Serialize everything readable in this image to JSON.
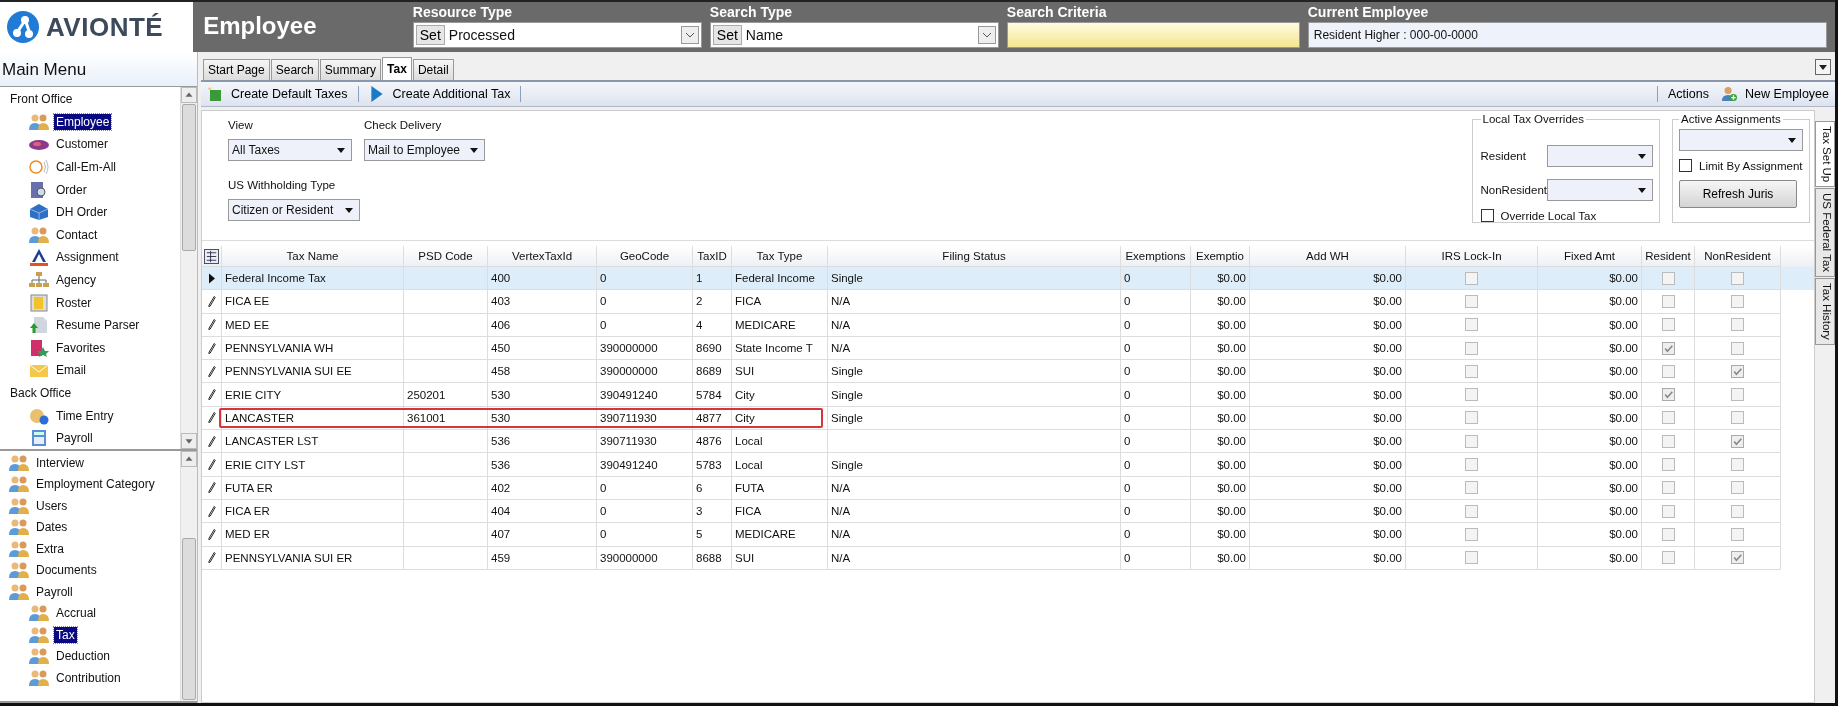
{
  "app": {
    "logo": "AVIONTÉ",
    "module": "Employee"
  },
  "header_fields": [
    {
      "label": "Resource Type",
      "kind": "set-select",
      "button": "Set",
      "value": "Processed"
    },
    {
      "label": "Search Type",
      "kind": "set-select",
      "button": "Set",
      "value": "Name"
    },
    {
      "label": "Search Criteria",
      "kind": "input"
    },
    {
      "label": "Current Employee",
      "kind": "display",
      "value": "Resident  Higher : 000-00-0000"
    }
  ],
  "main_menu": {
    "title": "Main Menu",
    "upper": [
      {
        "label": "Front Office",
        "selected": false,
        "children": [
          {
            "label": "Employee",
            "selected": true
          },
          {
            "label": "Customer",
            "selected": false
          },
          {
            "label": "Call-Em-All",
            "selected": false
          },
          {
            "label": "Order",
            "selected": false
          },
          {
            "label": "DH Order",
            "selected": false
          },
          {
            "label": "Contact",
            "selected": false
          },
          {
            "label": "Assignment",
            "selected": false
          },
          {
            "label": "Agency",
            "selected": false
          },
          {
            "label": "Roster",
            "selected": false
          },
          {
            "label": "Resume Parser",
            "selected": false
          },
          {
            "label": "Favorites",
            "selected": false
          },
          {
            "label": "Email",
            "selected": false
          }
        ]
      },
      {
        "label": "Back Office",
        "selected": false,
        "children": [
          {
            "label": "Time Entry",
            "selected": false
          },
          {
            "label": "Payroll",
            "selected": false
          }
        ]
      }
    ],
    "lower": [
      {
        "label": "Interview",
        "selected": false
      },
      {
        "label": "Employment Category",
        "selected": false
      },
      {
        "label": "Users",
        "selected": false
      },
      {
        "label": "Dates",
        "selected": false
      },
      {
        "label": "Extra",
        "selected": false
      },
      {
        "label": "Documents",
        "selected": false
      },
      {
        "label": "Payroll",
        "selected": false,
        "children": [
          {
            "label": "Accrual",
            "selected": false
          },
          {
            "label": "Tax",
            "selected": true
          },
          {
            "label": "Deduction",
            "selected": false
          },
          {
            "label": "Contribution",
            "selected": false
          }
        ]
      }
    ]
  },
  "tabs": [
    {
      "label": "Start Page",
      "selected": false
    },
    {
      "label": "Search",
      "selected": false
    },
    {
      "label": "Summary",
      "selected": false
    },
    {
      "label": "Tax",
      "selected": true
    },
    {
      "label": "Detail",
      "selected": false
    }
  ],
  "toolbar": {
    "left": [
      "Create Default Taxes",
      "Create Additional Tax"
    ],
    "actions": "Actions",
    "new_button": "New Employee"
  },
  "filters": {
    "view": {
      "label": "View",
      "value": "All Taxes"
    },
    "check_delivery": {
      "label": "Check Delivery",
      "value": "Mail to Employee"
    },
    "withholding": {
      "label": "US Withholding Type",
      "value": "Citizen or Resident"
    }
  },
  "local_overrides": {
    "title": "Local Tax Overrides",
    "resident_label": "Resident",
    "nonresident_label": "NonResident",
    "override": {
      "label": "Override Local Tax",
      "checked": false
    }
  },
  "active_assignments": {
    "title": "Active Assignments",
    "limit": {
      "label": "Limit By Assignment",
      "checked": false
    },
    "button": "Refresh Juris"
  },
  "grid": {
    "columns": [
      "Tax Name",
      "PSD Code",
      "VertexTaxId",
      "GeoCode",
      "TaxID",
      "Tax Type",
      "Filing Status",
      "Exemptions",
      "Exemptio",
      "Add WH",
      "IRS Lock-In",
      "Fixed Amt",
      "Resident",
      "NonResident"
    ],
    "rows": [
      {
        "current": true,
        "highlighted": false,
        "tax_name": "Federal Income Tax",
        "vertex": "400",
        "geo": "0",
        "tax_id": "1",
        "tax_type": "Federal Income",
        "filing": "Single",
        "exemptions": "0",
        "exemptio": "$0.00",
        "add_wh": "$0.00",
        "irs_lock_in": false,
        "fixed": "$0.00",
        "resident": false,
        "nonresident": false
      },
      {
        "current": false,
        "highlighted": false,
        "tax_name": "FICA EE",
        "vertex": "403",
        "geo": "0",
        "tax_id": "2",
        "tax_type": "FICA",
        "filing": "N/A",
        "exemptions": "0",
        "exemptio": "$0.00",
        "add_wh": "$0.00",
        "irs_lock_in": false,
        "fixed": "$0.00",
        "resident": false,
        "nonresident": false
      },
      {
        "current": false,
        "highlighted": false,
        "tax_name": "MED EE",
        "vertex": "406",
        "geo": "0",
        "tax_id": "4",
        "tax_type": "MEDICARE",
        "filing": "N/A",
        "exemptions": "0",
        "exemptio": "$0.00",
        "add_wh": "$0.00",
        "irs_lock_in": false,
        "fixed": "$0.00",
        "resident": false,
        "nonresident": false
      },
      {
        "current": false,
        "highlighted": false,
        "tax_name": "PENNSYLVANIA WH",
        "vertex": "450",
        "geo": "390000000",
        "tax_id": "8690",
        "tax_type": "State Income T",
        "filing": "N/A",
        "exemptions": "0",
        "exemptio": "$0.00",
        "add_wh": "$0.00",
        "irs_lock_in": false,
        "fixed": "$0.00",
        "resident": true,
        "nonresident": false
      },
      {
        "current": false,
        "highlighted": false,
        "tax_name": "PENNSYLVANIA SUI EE",
        "vertex": "458",
        "geo": "390000000",
        "tax_id": "8689",
        "tax_type": "SUI",
        "filing": "Single",
        "exemptions": "0",
        "exemptio": "$0.00",
        "add_wh": "$0.00",
        "irs_lock_in": false,
        "fixed": "$0.00",
        "resident": false,
        "nonresident": true
      },
      {
        "current": false,
        "highlighted": false,
        "tax_name": "ERIE CITY",
        "psd": "250201",
        "vertex": "530",
        "geo": "390491240",
        "tax_id": "5784",
        "tax_type": "City",
        "filing": "Single",
        "exemptions": "0",
        "exemptio": "$0.00",
        "add_wh": "$0.00",
        "irs_lock_in": false,
        "fixed": "$0.00",
        "resident": true,
        "nonresident": false
      },
      {
        "current": false,
        "highlighted": true,
        "tax_name": "LANCASTER",
        "psd": "361001",
        "vertex": "530",
        "geo": "390711930",
        "tax_id": "4877",
        "tax_type": "City",
        "filing": "Single",
        "exemptions": "0",
        "exemptio": "$0.00",
        "add_wh": "$0.00",
        "irs_lock_in": false,
        "fixed": "$0.00",
        "resident": false,
        "nonresident": false
      },
      {
        "current": false,
        "highlighted": false,
        "tax_name": "LANCASTER LST",
        "vertex": "536",
        "geo": "390711930",
        "tax_id": "4876",
        "tax_type": "Local",
        "exemptions": "0",
        "exemptio": "$0.00",
        "add_wh": "$0.00",
        "irs_lock_in": false,
        "fixed": "$0.00",
        "resident": false,
        "nonresident": true
      },
      {
        "current": false,
        "highlighted": false,
        "tax_name": "ERIE CITY LST",
        "vertex": "536",
        "geo": "390491240",
        "tax_id": "5783",
        "tax_type": "Local",
        "filing": "Single",
        "exemptions": "0",
        "exemptio": "$0.00",
        "add_wh": "$0.00",
        "irs_lock_in": false,
        "fixed": "$0.00",
        "resident": false,
        "nonresident": false
      },
      {
        "current": false,
        "highlighted": false,
        "tax_name": "FUTA ER",
        "vertex": "402",
        "geo": "0",
        "tax_id": "6",
        "tax_type": "FUTA",
        "filing": "N/A",
        "exemptions": "0",
        "exemptio": "$0.00",
        "add_wh": "$0.00",
        "irs_lock_in": false,
        "fixed": "$0.00",
        "resident": false,
        "nonresident": false
      },
      {
        "current": false,
        "highlighted": false,
        "tax_name": "FICA ER",
        "vertex": "404",
        "geo": "0",
        "tax_id": "3",
        "tax_type": "FICA",
        "filing": "N/A",
        "exemptions": "0",
        "exemptio": "$0.00",
        "add_wh": "$0.00",
        "irs_lock_in": false,
        "fixed": "$0.00",
        "resident": false,
        "nonresident": false
      },
      {
        "current": false,
        "highlighted": false,
        "tax_name": "MED ER",
        "vertex": "407",
        "geo": "0",
        "tax_id": "5",
        "tax_type": "MEDICARE",
        "filing": "N/A",
        "exemptions": "0",
        "exemptio": "$0.00",
        "add_wh": "$0.00",
        "irs_lock_in": false,
        "fixed": "$0.00",
        "resident": false,
        "nonresident": false
      },
      {
        "current": false,
        "highlighted": false,
        "tax_name": "PENNSYLVANIA SUI ER",
        "vertex": "459",
        "geo": "390000000",
        "tax_id": "8688",
        "tax_type": "SUI",
        "filing": "N/A",
        "exemptions": "0",
        "exemptio": "$0.00",
        "add_wh": "$0.00",
        "irs_lock_in": false,
        "fixed": "$0.00",
        "resident": false,
        "nonresident": true
      }
    ]
  },
  "side_tabs": [
    {
      "label": "Tax Set Up",
      "selected": true
    },
    {
      "label": "US Federal Tax",
      "selected": false
    },
    {
      "label": "Tax History",
      "selected": false
    }
  ]
}
